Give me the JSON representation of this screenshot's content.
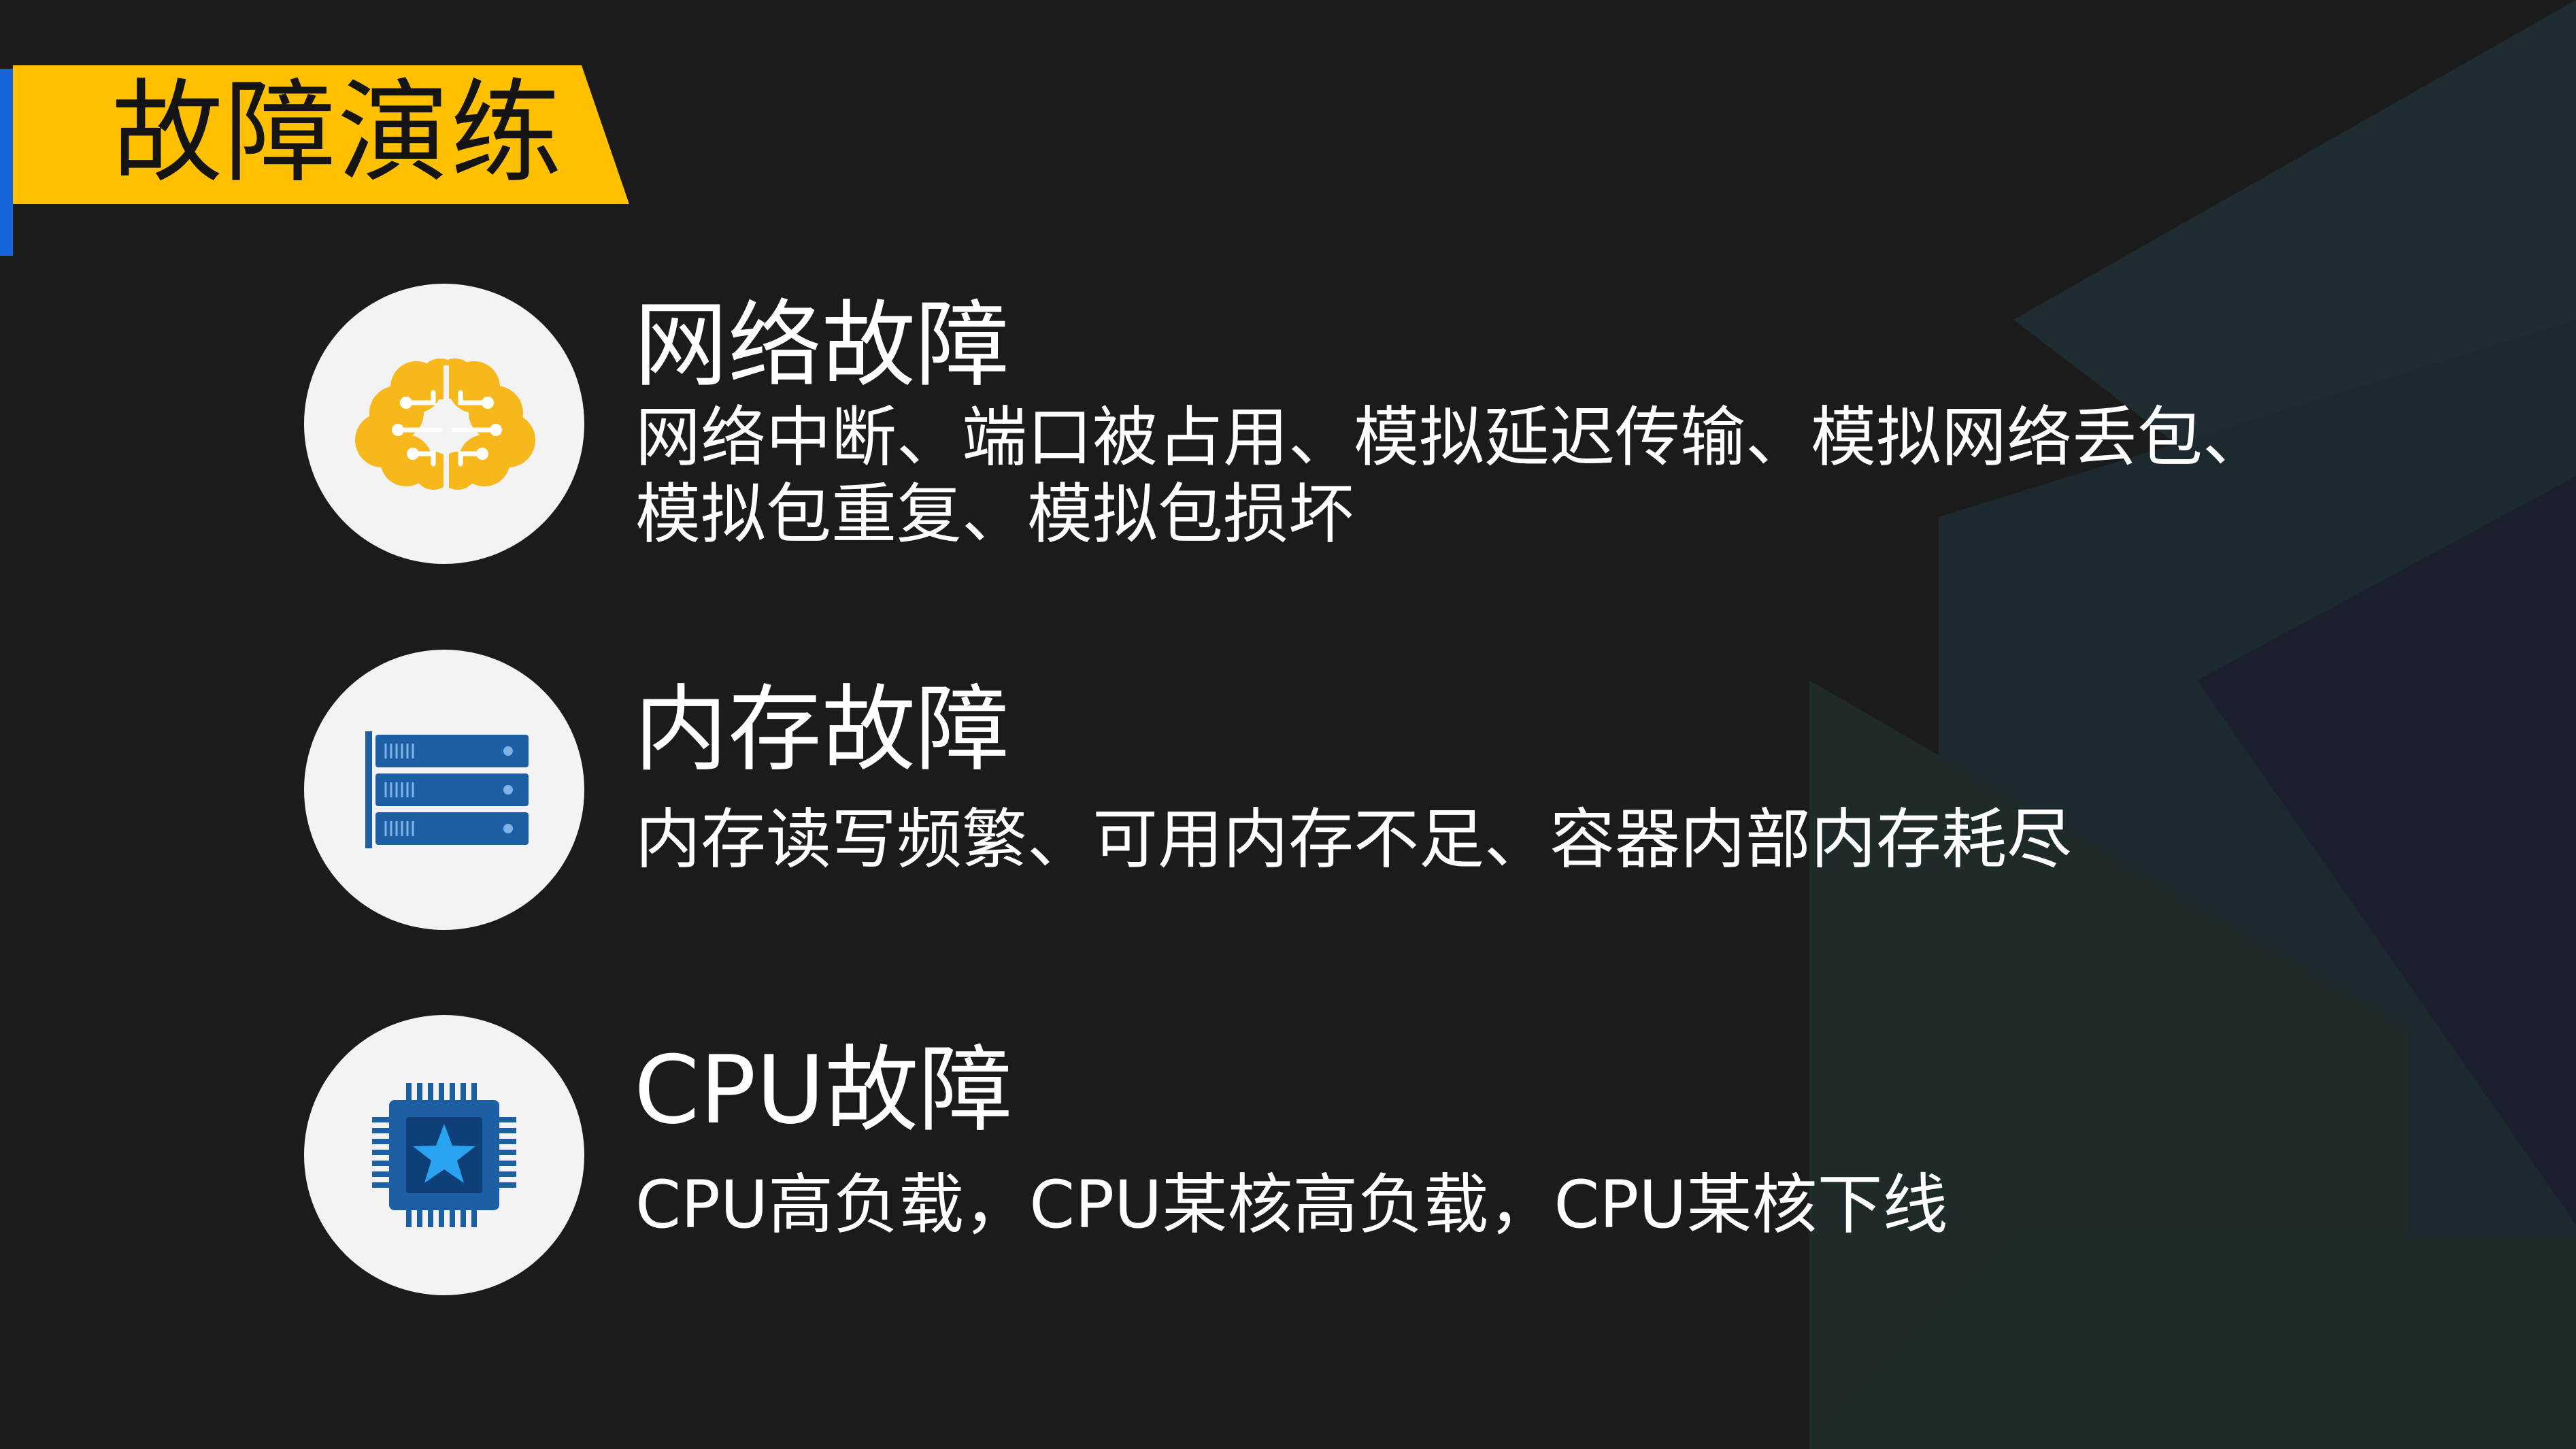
{
  "slide": {
    "title": "故障演练",
    "accent_color": "#ffc000",
    "stripe_color": "#1565d8",
    "background_color": "#1b1b1b"
  },
  "items": [
    {
      "title": "网络故障",
      "description": "网络中断、端口被占用、模拟延迟传输、模拟网络丢包、模拟包重复、模拟包损坏",
      "icon": "brain-circuit-icon",
      "icon_color": "#f6b81a"
    },
    {
      "title": "内存故障",
      "description": "内存读写频繁、可用内存不足、容器内部内存耗尽",
      "icon": "server-rack-icon",
      "icon_color": "#1d5fa5"
    },
    {
      "title": "CPU故障",
      "description": "CPU高负载，CPU某核高负载，CPU某核下线",
      "icon": "cpu-chip-icon",
      "icon_color": "#1d5fa5"
    }
  ]
}
